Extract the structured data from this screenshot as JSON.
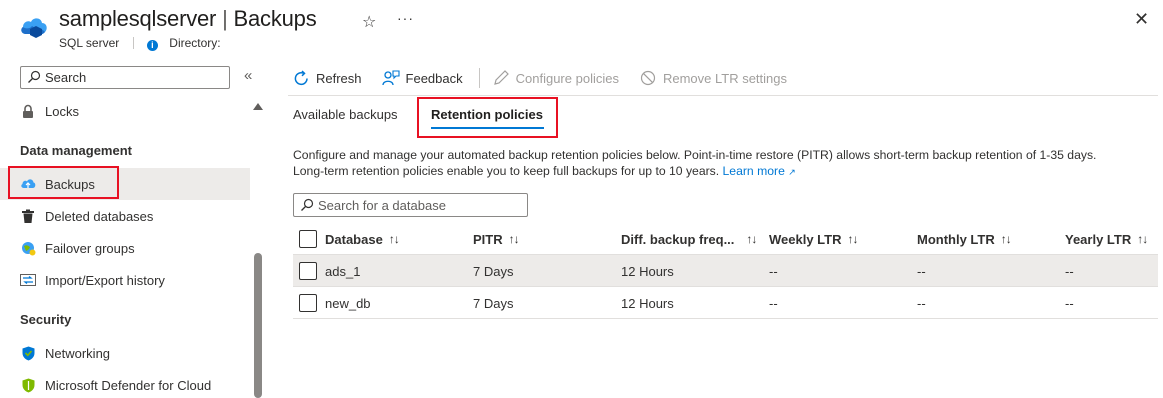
{
  "header": {
    "resource_name": "samplesqlserver",
    "separator": "|",
    "page_name": "Backups",
    "resource_type": "SQL server",
    "directory_label": "Directory:"
  },
  "sidebar": {
    "search_placeholder": "Search",
    "items": [
      {
        "label": "Locks",
        "icon": "lock-icon"
      },
      {
        "label": "Data management",
        "heading": true
      },
      {
        "label": "Backups",
        "icon": "cloud-backup-icon",
        "active": true
      },
      {
        "label": "Deleted databases",
        "icon": "trash-icon"
      },
      {
        "label": "Failover groups",
        "icon": "globe-icon"
      },
      {
        "label": "Import/Export history",
        "icon": "import-export-icon"
      },
      {
        "label": "Security",
        "heading": true
      },
      {
        "label": "Networking",
        "icon": "shield-network-icon"
      },
      {
        "label": "Microsoft Defender for Cloud",
        "icon": "defender-shield-icon"
      }
    ]
  },
  "toolbar": {
    "refresh": "Refresh",
    "feedback": "Feedback",
    "configure_policies": "Configure policies",
    "remove_ltr": "Remove LTR settings"
  },
  "tabs": {
    "available": "Available backups",
    "retention": "Retention policies"
  },
  "description": {
    "line1": "Configure and manage your automated backup retention policies below. Point-in-time restore (PITR) allows short-term backup retention of 1-35 days.",
    "line2": "Long-term retention policies enable you to keep full backups for up to 10 years.",
    "learn_more": "Learn more"
  },
  "db_search_placeholder": "Search for a database",
  "table": {
    "columns": [
      "Database",
      "PITR",
      "Diff. backup freq...",
      "Weekly LTR",
      "Monthly LTR",
      "Yearly LTR"
    ],
    "sort_glyph": "↑↓",
    "rows": [
      {
        "database": "ads_1",
        "pitr": "7 Days",
        "diff": "12 Hours",
        "weekly": "--",
        "monthly": "--",
        "yearly": "--"
      },
      {
        "database": "new_db",
        "pitr": "7 Days",
        "diff": "12 Hours",
        "weekly": "--",
        "monthly": "--",
        "yearly": "--"
      }
    ]
  },
  "colors": {
    "accent": "#0078d4",
    "highlight_box": "#e81123",
    "selected_bg": "#edebe9"
  }
}
